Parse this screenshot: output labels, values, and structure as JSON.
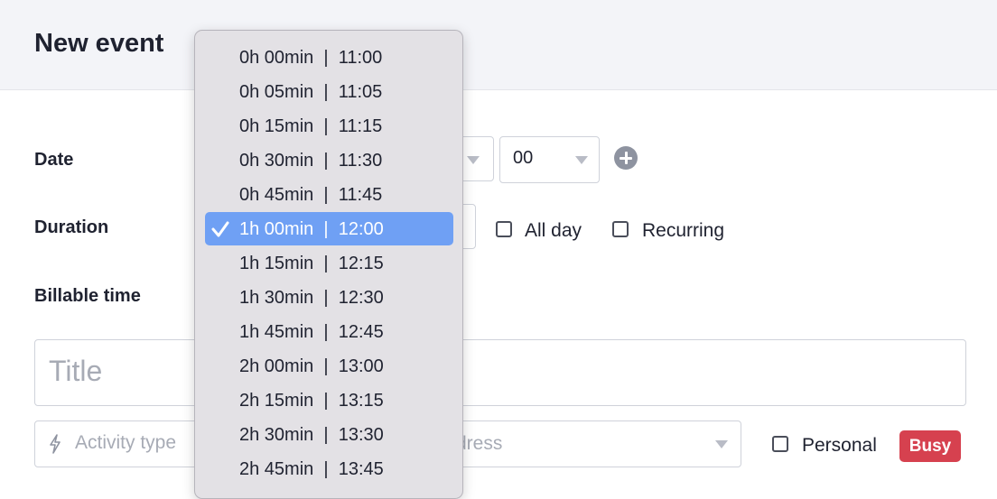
{
  "header": {
    "title": "New event"
  },
  "form": {
    "date_label": "Date",
    "duration_label": "Duration",
    "billable_label": "Billable time",
    "minute_value": "00",
    "allday_label": "All day",
    "recurring_label": "Recurring",
    "title_placeholder": "Title",
    "activity_placeholder": "Activity type",
    "address_placeholder": "dress",
    "personal_label": "Personal",
    "busy_label": "Busy"
  },
  "dropdown": {
    "selected_index": 5,
    "items": [
      "0h 00min  |  11:00",
      "0h 05min  |  11:05",
      "0h 15min  |  11:15",
      "0h 30min  |  11:30",
      "0h 45min  |  11:45",
      "1h 00min  |  12:00",
      "1h 15min  |  12:15",
      "1h 30min  |  12:30",
      "1h 45min  |  12:45",
      "2h 00min  |  13:00",
      "2h 15min  |  13:15",
      "2h 30min  |  13:30",
      "2h 45min  |  13:45"
    ]
  },
  "colors": {
    "selected_bg": "#6fa0f4",
    "busy_badge": "#d6414f",
    "header_bg": "#f3f4f8"
  }
}
